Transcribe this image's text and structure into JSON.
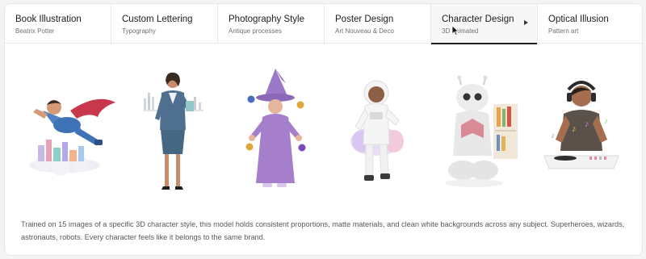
{
  "tabs": [
    {
      "title": "Book Illustration",
      "subtitle": "Beatrix Potter",
      "active": false
    },
    {
      "title": "Custom Lettering",
      "subtitle": "Typography",
      "active": false
    },
    {
      "title": "Photography Style",
      "subtitle": "Antique processes",
      "active": false
    },
    {
      "title": "Poster Design",
      "subtitle": "Art Nouveau & Deco",
      "active": false
    },
    {
      "title": "Character Design",
      "subtitle": "3D animated",
      "active": true
    },
    {
      "title": "Optical Illusion",
      "subtitle": "Pattern art",
      "active": false
    }
  ],
  "gallery": {
    "images": [
      {
        "icon": "superhero-figure"
      },
      {
        "icon": "businesswoman-figure"
      },
      {
        "icon": "wizard-figure"
      },
      {
        "icon": "astronaut-figure"
      },
      {
        "icon": "robot-figure"
      },
      {
        "icon": "dj-figure"
      }
    ]
  },
  "description": "Trained on 15 images of a specific 3D character style, this model holds consistent proportions, matte materials, and clean white backgrounds across any subject. Superheroes, wizards, astronauts, robots. Every character feels like it belongs to the same brand.",
  "colors": {
    "active_underline": "#1f1f1f",
    "border": "#e8e8e8"
  }
}
